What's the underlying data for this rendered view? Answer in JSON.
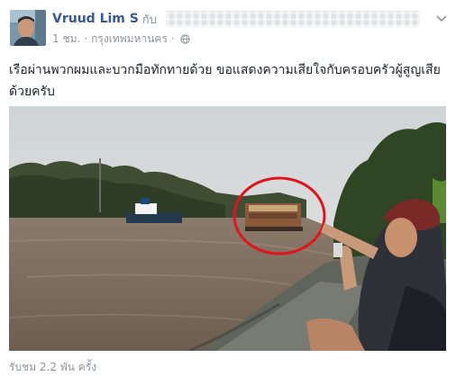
{
  "post": {
    "author": "Vruud Lim S",
    "with_word": "กับ",
    "time": "1 ชม.",
    "separator": "·",
    "location": "กรุงเทพมหานคร",
    "text": "เรือผ่านพวกผมและบวกมือทักทายด้วย ขอแสดงความเสียใจกับครอบครัวผู้สูญเสียด้วยครับ",
    "views": "รับชม 2.2 พัน ครั้ง"
  },
  "icons": {
    "chevron": "chevron-down-icon",
    "privacy": "globe-icon"
  },
  "colors": {
    "author_link": "#365899",
    "meta_text": "#90949c",
    "body_text": "#1d2129",
    "highlight_circle": "#e0141e"
  }
}
